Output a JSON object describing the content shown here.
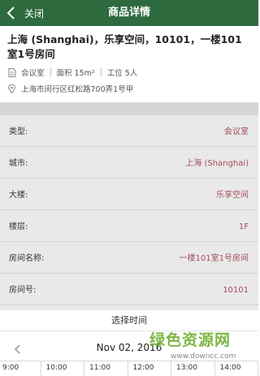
{
  "header": {
    "back_label": "关闭",
    "title": "商品详情"
  },
  "summary": {
    "title": "上海 (Shanghai)，乐享空间，10101，一楼101室1号房间",
    "meta": {
      "type": "会议室",
      "area": "面积 15m²",
      "seats": "工位 5人"
    },
    "address": "上海市闵行区红松路700弄1号甲"
  },
  "details": [
    {
      "label": "类型:",
      "value": "会议室"
    },
    {
      "label": "城市:",
      "value": "上海 (Shanghai)"
    },
    {
      "label": "大楼:",
      "value": "乐享空间"
    },
    {
      "label": "楼层:",
      "value": "1F"
    },
    {
      "label": "房间名称:",
      "value": "一楼101室1号房间"
    },
    {
      "label": "房间号:",
      "value": "10101"
    }
  ],
  "picker": {
    "title": "选择时间",
    "date": "Nov 02, 2016",
    "times": [
      "9:00",
      "10:00",
      "11:00",
      "12:00",
      "13:00",
      "14:00"
    ]
  },
  "watermark": {
    "text": "绿色资源网",
    "url": "www.downcc.com"
  },
  "colors": {
    "header_bg": "#2d6a3e",
    "value_text": "#a44a5a",
    "section_bg": "#e9e9e9"
  }
}
